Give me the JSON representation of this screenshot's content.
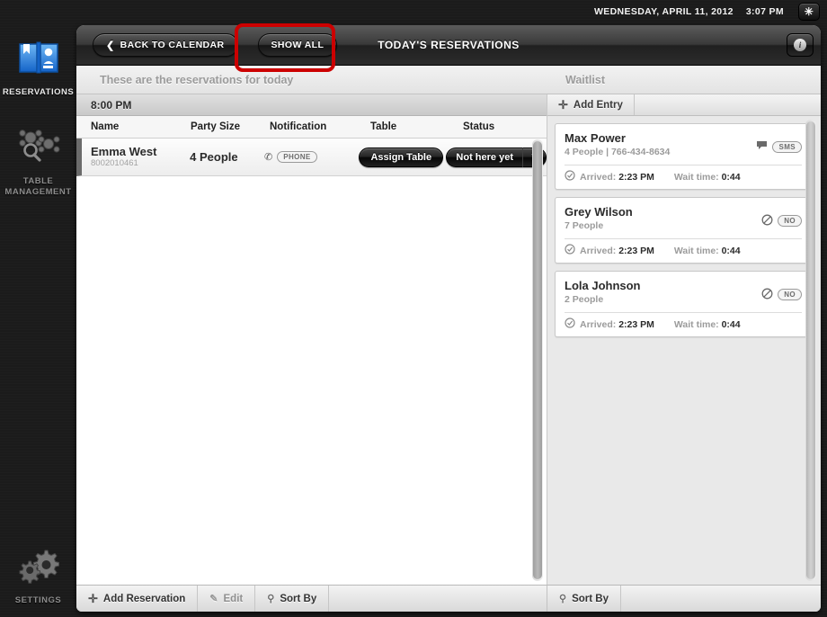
{
  "statusbar": {
    "date": "WEDNESDAY, APRIL 11, 2012",
    "time": "3:07 PM",
    "close_icon": "close-icon",
    "close_glyph": "✳"
  },
  "sidebar": {
    "items": [
      {
        "label": "RESERVATIONS",
        "icon": "book-icon",
        "active": true
      },
      {
        "label": "TABLE\nMANAGEMENT",
        "line1": "TABLE",
        "line2": "MANAGEMENT",
        "icon": "table-management-icon",
        "active": false
      },
      {
        "label": "SETTINGS",
        "icon": "gears-icon",
        "active": false
      }
    ]
  },
  "titlebar": {
    "back_label": "BACK TO CALENDAR",
    "back_chevron": "❮",
    "show_all_label": "SHOW ALL",
    "title": "TODAY'S RESERVATIONS",
    "info_glyph": "i",
    "info_icon": "info-icon"
  },
  "left_panel": {
    "subtitle": "These are the reservations for today",
    "time_group": "8:00 PM",
    "columns": [
      "Name",
      "Party Size",
      "Notification",
      "Table",
      "Status"
    ],
    "reservations": [
      {
        "name": "Emma West",
        "phone": "8002010461",
        "party_size": "4 People",
        "notification_glyph": "✆",
        "notification_badge": "PHONE",
        "table_action": "Assign Table",
        "status": "Not here yet",
        "status_arrow": "▼"
      }
    ]
  },
  "right_panel": {
    "title": "Waitlist",
    "add_entry_label": "Add Entry",
    "add_entry_glyph": "✛",
    "entries": [
      {
        "name": "Max Power",
        "meta": "4 People | 766-434-8634",
        "flag_glyph": "speech-bubble",
        "flag_badge": "SMS",
        "arrived_label": "Arrived:",
        "arrived_time": "2:23 PM",
        "wait_label": "Wait time:",
        "wait_time": "0:44",
        "check_glyph": "✓"
      },
      {
        "name": "Grey Wilson",
        "meta": "7 People",
        "flag_glyph": "ban",
        "flag_badge": "NO",
        "arrived_label": "Arrived:",
        "arrived_time": "2:23 PM",
        "wait_label": "Wait time:",
        "wait_time": "0:44",
        "check_glyph": "✓"
      },
      {
        "name": "Lola Johnson",
        "meta": "2 People",
        "flag_glyph": "ban",
        "flag_badge": "NO",
        "arrived_label": "Arrived:",
        "arrived_time": "2:23 PM",
        "wait_label": "Wait time:",
        "wait_time": "0:44",
        "check_glyph": "✓"
      }
    ]
  },
  "bottombar": {
    "add_reservation": "Add Reservation",
    "add_glyph": "✛",
    "edit": "Edit",
    "edit_glyph": "✎",
    "sort_by": "Sort By",
    "sort_glyph": "⚲",
    "waitlist_sort_by": "Sort By"
  },
  "annotation": {
    "highlight_target": "show-all-button",
    "highlight_color": "#cc0000"
  }
}
